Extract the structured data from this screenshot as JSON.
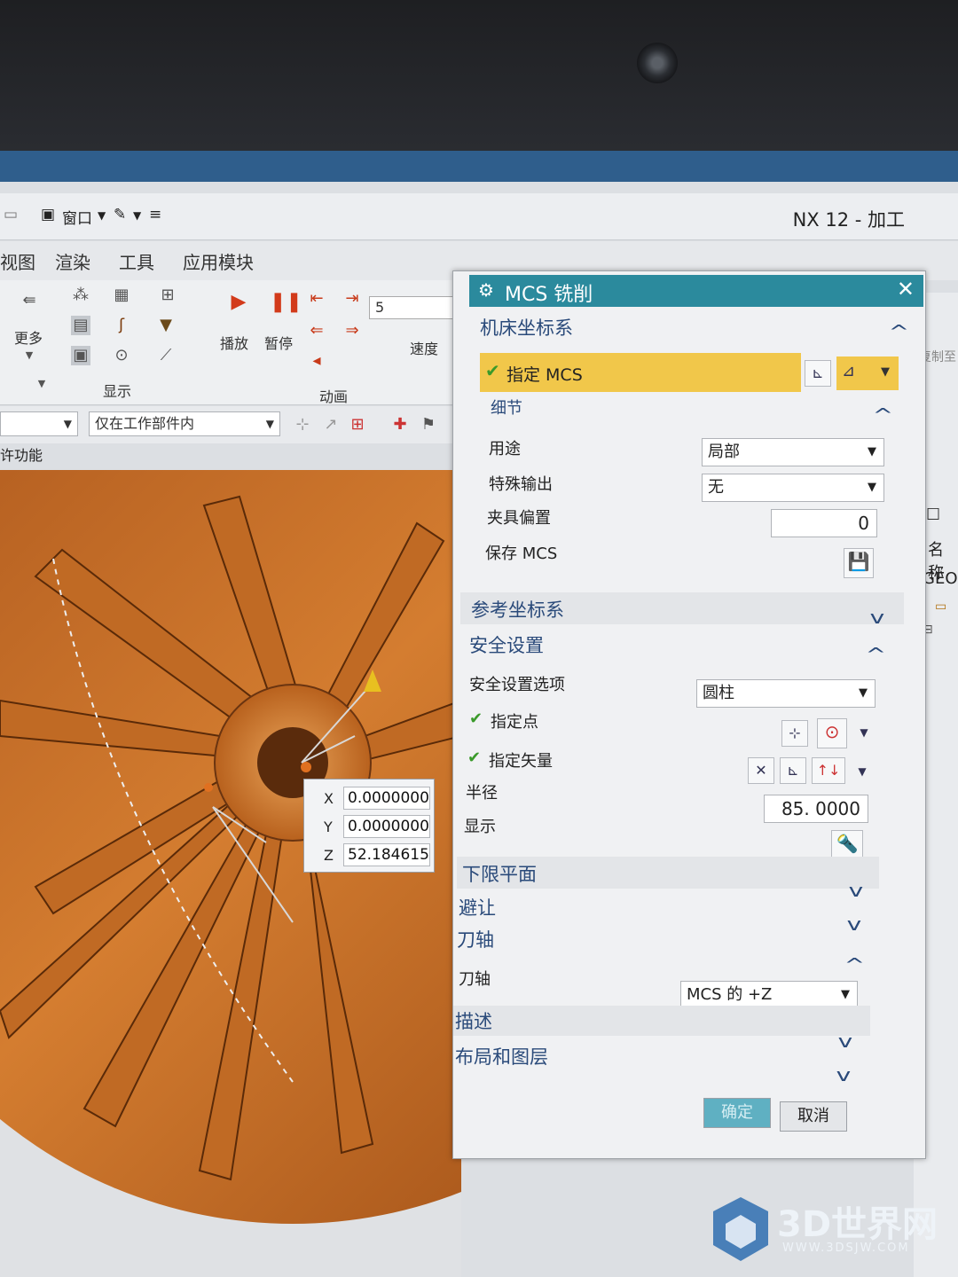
{
  "app": {
    "title": "NX 12 - 加工",
    "quick_access": {
      "window_label": "窗口"
    },
    "menu": [
      "视图",
      "渲染",
      "工具",
      "应用模块"
    ]
  },
  "ribbon": {
    "more_label": "更多",
    "display_label": "显示",
    "animation_label": "动画",
    "play_label": "播放",
    "pause_label": "暂停",
    "speed_label": "速度",
    "speed_value": "5",
    "selection_scope": "仅在工作部件内",
    "function_label": "许功能"
  },
  "coords": {
    "x_label": "X",
    "x_value": "0.0000000",
    "y_label": "Y",
    "y_value": "0.0000000",
    "z_label": "Z",
    "z_value": "52.184615"
  },
  "dialog": {
    "title": "MCS 铣削",
    "machine_cs": {
      "header": "机床坐标系",
      "specify_mcs": "指定 MCS",
      "details_header": "细节",
      "purpose_label": "用途",
      "purpose_value": "局部",
      "special_output_label": "特殊输出",
      "special_output_value": "无",
      "fixture_offset_label": "夹具偏置",
      "fixture_offset_value": "0",
      "save_mcs_label": "保存 MCS"
    },
    "reference_cs": {
      "header": "参考坐标系"
    },
    "safety": {
      "header": "安全设置",
      "option_label": "安全设置选项",
      "option_value": "圆柱",
      "specify_point": "指定点",
      "specify_vector": "指定矢量",
      "radius_label": "半径",
      "radius_value": "85. 0000",
      "display_label": "显示"
    },
    "lower_plane": {
      "header": "下限平面"
    },
    "avoidance": {
      "header": "避让"
    },
    "tool_axis": {
      "header": "刀轴",
      "axis_label": "刀轴",
      "axis_value": "MCS 的 +Z"
    },
    "description": {
      "header": "描述"
    },
    "layout": {
      "header": "布局和图层"
    },
    "ok_label": "确定",
    "cancel_label": "取消"
  },
  "side_panel": {
    "name_label": "名称",
    "geo_label": "GEO",
    "copy_label": "复制至"
  },
  "watermark": {
    "brand": "3D世界网",
    "url": "WWW.3DSJW.COM"
  },
  "colors": {
    "dialog_title_bar": "#2b8a9d",
    "highlight_row": "#f1c74a",
    "impeller": "#c8702a"
  }
}
